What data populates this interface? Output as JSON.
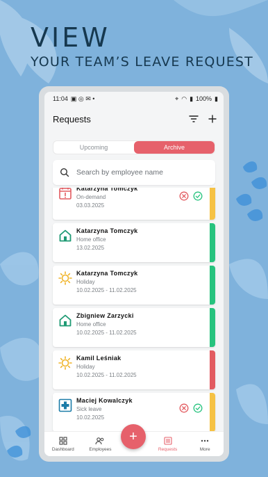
{
  "promo": {
    "headline": "VIEW",
    "subline": "YOUR TEAM’S LEAVE REQUEST"
  },
  "status": {
    "time": "11:04",
    "battery": "100%"
  },
  "appbar": {
    "title": "Requests",
    "filter_icon": "filter-icon",
    "add_icon": "plus-icon"
  },
  "tabs": [
    {
      "label": "Upcoming",
      "active": false
    },
    {
      "label": "Archive",
      "active": true
    }
  ],
  "search": {
    "placeholder": "Search by employee name"
  },
  "colors": {
    "accent": "#e6616b",
    "pending": "#f6c244",
    "approved": "#27c37e",
    "rejected": "#e25b60",
    "home": "#1f9a74",
    "holiday": "#f0b429",
    "sick": "#1c7ca8"
  },
  "requests": [
    {
      "name": "Katarzyna Tomczyk",
      "type": "On-demand",
      "date": "03.03.2025",
      "icon": "calendar-alert-icon",
      "status": "pending",
      "actions": true
    },
    {
      "name": "Katarzyna Tomczyk",
      "type": "Home office",
      "date": "13.02.2025",
      "icon": "home-icon",
      "status": "approved",
      "actions": false
    },
    {
      "name": "Katarzyna Tomczyk",
      "type": "Holiday",
      "date": "10.02.2025 - 11.02.2025",
      "icon": "sun-icon",
      "status": "approved",
      "actions": false
    },
    {
      "name": "Zbigniew Zarzycki",
      "type": "Home office",
      "date": "10.02.2025 - 11.02.2025",
      "icon": "home-icon",
      "status": "approved",
      "actions": false
    },
    {
      "name": "Kamil Leśniak",
      "type": "Holiday",
      "date": "10.02.2025 - 11.02.2025",
      "icon": "sun-icon",
      "status": "rejected",
      "actions": false
    },
    {
      "name": "Maciej Kowalczyk",
      "type": "Sick leave",
      "date": "10.02.2025",
      "icon": "medical-cross-icon",
      "status": "pending",
      "actions": true
    }
  ],
  "nav": [
    {
      "label": "Dashboard",
      "icon": "dashboard-icon",
      "active": false
    },
    {
      "label": "Employees",
      "icon": "people-icon",
      "active": false
    },
    {
      "label": "Requests",
      "icon": "list-icon",
      "active": true
    },
    {
      "label": "More",
      "icon": "more-icon",
      "active": false
    }
  ],
  "fab": {
    "label": "+"
  }
}
